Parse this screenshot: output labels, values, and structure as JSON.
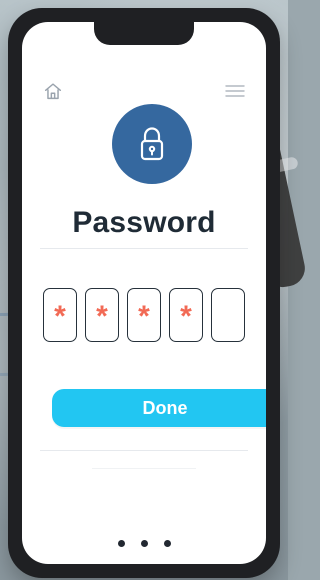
{
  "screen": {
    "title": "Password",
    "pin": {
      "length": 5,
      "filled": [
        "*",
        "*",
        "*",
        "*",
        ""
      ]
    },
    "primary_action": {
      "label": "Done"
    },
    "pagination": {
      "total": 3,
      "active_index": 1
    }
  },
  "icons": {
    "home": "home-icon",
    "menu": "menu-icon",
    "lock": "lock-icon"
  },
  "colors": {
    "accent": "#22C6F2",
    "lock_circle": "#35689F",
    "pin_asterisk": "#F26A55",
    "title_text": "#1F2B36"
  }
}
